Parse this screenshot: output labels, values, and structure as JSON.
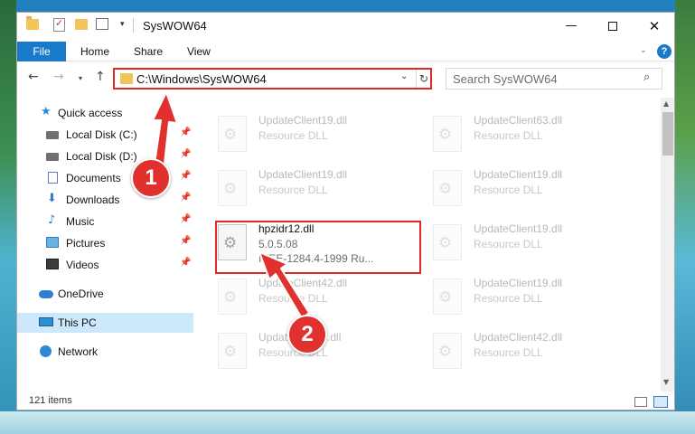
{
  "window": {
    "title": "SysWOW64",
    "minimize_glyph": "—",
    "maximize_label": "",
    "close_glyph": "✕"
  },
  "ribbon": {
    "file_label": "File",
    "tabs": [
      "Home",
      "Share",
      "View"
    ],
    "help_label": "?"
  },
  "nav": {
    "back_glyph": "←",
    "forward_glyph": "→",
    "recent_glyph": "▾",
    "up_glyph": "↑",
    "address": "C:\\Windows\\SysWOW64",
    "search_placeholder": "Search SysWOW64"
  },
  "sidebar": {
    "items": [
      {
        "label": "Quick access",
        "icon": "star-icon"
      },
      {
        "label": "Local Disk (C:)",
        "icon": "disk-icon",
        "pinned": true
      },
      {
        "label": "Local Disk (D:)",
        "icon": "disk-icon",
        "pinned": true
      },
      {
        "label": "Documents",
        "icon": "documents-icon",
        "pinned": true
      },
      {
        "label": "Downloads",
        "icon": "downloads-icon",
        "pinned": true
      },
      {
        "label": "Music",
        "icon": "music-icon",
        "pinned": true
      },
      {
        "label": "Pictures",
        "icon": "pictures-icon",
        "pinned": true
      },
      {
        "label": "Videos",
        "icon": "videos-icon",
        "pinned": true
      },
      {
        "label": "OneDrive",
        "icon": "onedrive-icon"
      },
      {
        "label": "This PC",
        "icon": "this-pc-icon",
        "selected": true
      },
      {
        "label": "Network",
        "icon": "network-icon"
      }
    ]
  },
  "files": [
    {
      "name": "UpdateClient19.dll",
      "type": "Resource DLL"
    },
    {
      "name": "UpdateClient63.dll",
      "type": "Resource DLL"
    },
    {
      "name": "UpdateClient19.dll",
      "type": "Resource DLL"
    },
    {
      "name": "UpdateClient19.dll",
      "type": "Resource DLL"
    },
    {
      "name": "hpzidr12.dll",
      "version": "5.0.5.08",
      "description": "IEEE-1284.4-1999 Ru...",
      "selected": true
    },
    {
      "name": "UpdateClient19.dll",
      "type": "Resource DLL"
    },
    {
      "name": "UpdateClient42.dll",
      "type": "Resource DLL"
    },
    {
      "name": "UpdateClient19.dll",
      "type": "Resource DLL"
    },
    {
      "name": "UpdateClient5.dll",
      "type": "Resource DLL"
    },
    {
      "name": "UpdateClient42.dll",
      "type": "Resource DLL"
    }
  ],
  "status": {
    "item_count": "121 items"
  },
  "annotations": {
    "step1": "1",
    "step2": "2",
    "color": "#e1312f"
  }
}
